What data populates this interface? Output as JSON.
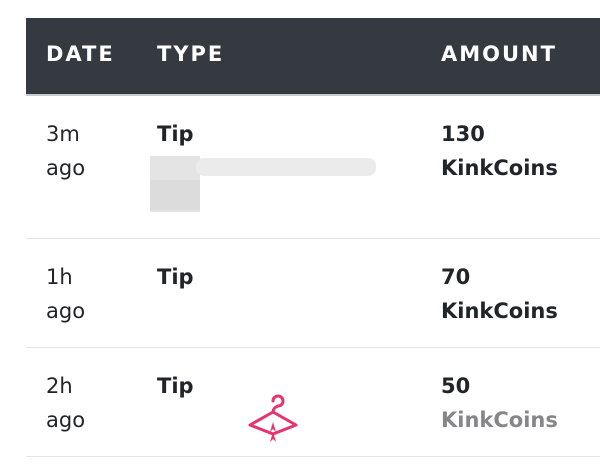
{
  "table": {
    "columns": [
      "DATE",
      "TYPE",
      "AMOUNT"
    ],
    "rows": [
      {
        "date_num": "3m",
        "date_unit": "ago",
        "type": "Tip",
        "amount_value": "130",
        "amount_currency": "KinkCoins"
      },
      {
        "date_num": "1h",
        "date_unit": "ago",
        "type": "Tip",
        "amount_value": "70",
        "amount_currency": "KinkCoins"
      },
      {
        "date_num": "2h",
        "date_unit": "ago",
        "type": "Tip",
        "amount_value": "50",
        "amount_currency": "KinkCoins"
      }
    ]
  },
  "icons": {
    "watermark": "hanger-icon"
  },
  "colors": {
    "header_bg": "#343a40",
    "header_text": "#ffffff",
    "body_text": "#212529",
    "accent": "#e8336d"
  }
}
